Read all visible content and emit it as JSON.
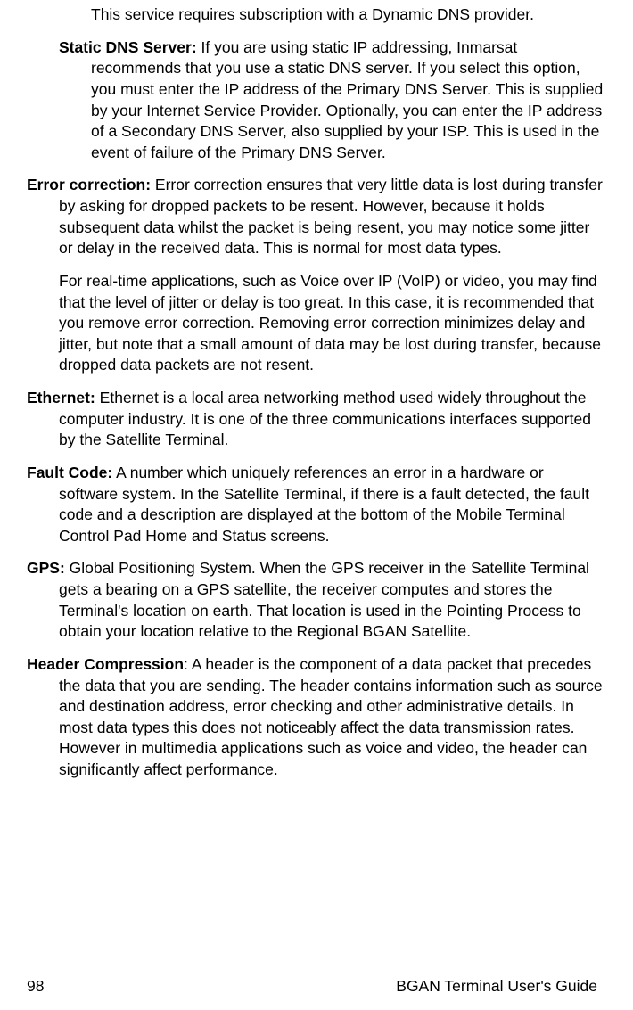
{
  "intro_para": "This service requires subscription with a Dynamic DNS provider.",
  "static_dns": {
    "term": "Static DNS Server:",
    "text": " If you are using static IP addressing, Inmarsat recommends that you use a static DNS server. If you select this option, you must enter the IP address of the Primary DNS Server. This is supplied by your Internet Service Provider. Optionally, you can enter the IP address of a Secondary DNS Server, also supplied by your ISP. This is used in the event of failure of the Primary DNS Server."
  },
  "error_correction": {
    "term": "Error correction:",
    "text1": " Error correction ensures that very little data is lost during transfer by asking for dropped packets to be resent. However, because it holds subsequent data whilst the packet is being resent, you may notice some jitter or delay in the received data. This is normal for most data types.",
    "text2": "For real-time applications, such as Voice over IP (VoIP) or video, you may find that the level of jitter or delay is too great. In this case, it is recommended that you remove error correction. Removing error correction minimizes delay and jitter, but note that a small amount of data may be lost during transfer, because dropped data packets are not resent."
  },
  "ethernet": {
    "term": "Ethernet:",
    "text": " Ethernet is a local area networking method used widely throughout the computer industry. It is one of the three communications interfaces supported by the Satellite Terminal."
  },
  "fault_code": {
    "term": "Fault Code:",
    "text": " A number which uniquely references an error in a hardware or software system. In the Satellite Terminal, if there is a fault detected, the fault code and a description are displayed at the bottom of the Mobile Terminal Control Pad Home and Status screens."
  },
  "gps": {
    "term": "GPS:",
    "text": " Global Positioning System. When the GPS receiver in the Satellite Terminal gets a bearing on a GPS satellite, the receiver computes and stores the Terminal's location on earth. That location is used in the Pointing Process to obtain your location relative to the Regional BGAN Satellite."
  },
  "header_compression": {
    "term": "Header Compression",
    "text": ": A header is the component of a data packet that precedes the data that you are sending. The header contains information such as source and destination address, error checking and other administrative details. In most data types this does not noticeably affect the data transmission rates. However in multimedia applications such as voice and video, the header can significantly affect performance."
  },
  "footer": {
    "page_number": "98",
    "doc_title": "BGAN Terminal User's Guide"
  }
}
